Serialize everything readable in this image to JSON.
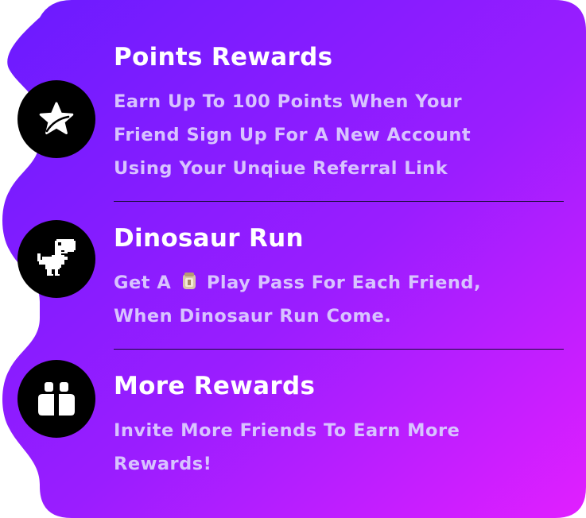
{
  "colors": {
    "gradient_start": "#6a1bff",
    "gradient_end": "#e01fff",
    "title": "#ffffff",
    "description": "#d8c3ff",
    "divider": "#1a0b3a",
    "icon_circle": "#000000"
  },
  "rewards": [
    {
      "icon": "star-icon",
      "title": "Points Rewards",
      "description_lines": [
        "Earn Up To 100 Points  When Your",
        "Friend Sign Up For A New Account",
        "Using Your Unqiue Referral Link"
      ]
    },
    {
      "icon": "dinosaur-icon",
      "title": "Dinosaur Run",
      "description_prefix": "Get A",
      "description_inline_icon": "play-pass-icon",
      "description_suffix": "Play Pass For Each Friend,",
      "description_line2": "When Dinosaur Run Come."
    },
    {
      "icon": "friends-icon",
      "title": "More Rewards",
      "description_lines": [
        "Invite More Friends To Earn More",
        "Rewards!"
      ]
    }
  ]
}
